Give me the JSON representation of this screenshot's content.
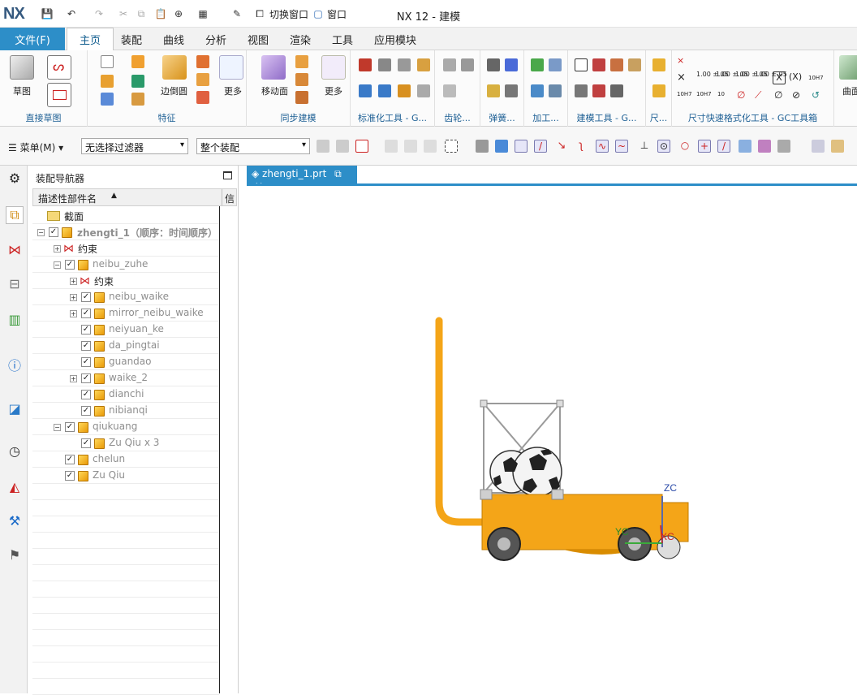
{
  "app": {
    "logo": "NX",
    "title": "NX 12 - 建模"
  },
  "quick_access": {
    "switch_window": "切换窗口",
    "window": "窗口"
  },
  "menu_tabs": [
    "文件(F)",
    "主页",
    "装配",
    "曲线",
    "分析",
    "视图",
    "渲染",
    "工具",
    "应用模块"
  ],
  "active_tab": "主页",
  "ribbon": {
    "sketch_btn": "草图",
    "edge_blend_btn": "边倒圆",
    "more_btn": "更多",
    "move_face_btn": "移动面",
    "more2_btn": "更多",
    "groups": [
      "直接草图",
      "特征",
      "同步建模",
      "标准化工具 - G...",
      "齿轮...",
      "弹簧...",
      "加工...",
      "建模工具 - G...",
      "尺...",
      "尺寸快速格式化工具 - GC工具箱"
    ],
    "dim_values": [
      "1.00\n±.05",
      "1.00\n±.05",
      "1.00\n±.05",
      "1.00\n±.05"
    ],
    "tol_labels": [
      "10H7",
      "10H7",
      "10",
      "10H7"
    ],
    "curve_btn": "曲面"
  },
  "selection_bar": {
    "menu": "菜单(M)",
    "filter": "无选择过滤器",
    "scope": "整个装配"
  },
  "navigator": {
    "title": "装配导航器",
    "column_name": "描述性部件名",
    "column_info": "信",
    "rows": [
      {
        "label": "截面",
        "gray": false
      },
      {
        "label": "zhengti_1（顺序：时间顺序）",
        "gray": true
      },
      {
        "label": "约束",
        "gray": false
      },
      {
        "label": "neibu_zuhe",
        "gray": true
      },
      {
        "label": "约束",
        "gray": false
      },
      {
        "label": "neibu_waike",
        "gray": true
      },
      {
        "label": "mirror_neibu_waike",
        "gray": true
      },
      {
        "label": "neiyuan_ke",
        "gray": true
      },
      {
        "label": "da_pingtai",
        "gray": true
      },
      {
        "label": "guandao",
        "gray": true
      },
      {
        "label": "waike_2",
        "gray": true
      },
      {
        "label": "dianchi",
        "gray": true
      },
      {
        "label": "nibianqi",
        "gray": true
      },
      {
        "label": "qiukuang",
        "gray": true
      },
      {
        "label": "Zu Qiu x 3",
        "gray": true
      },
      {
        "label": "chelun",
        "gray": true
      },
      {
        "label": "Zu Qiu",
        "gray": true
      }
    ]
  },
  "document": {
    "tab_label": "zhengti_1.prt"
  },
  "axes": {
    "zc": "ZC",
    "xc": "XC",
    "yc": "YC"
  },
  "colors": {
    "accent": "#2d8ec8",
    "body": "#f4a518",
    "frame": "#b0b0b0"
  }
}
